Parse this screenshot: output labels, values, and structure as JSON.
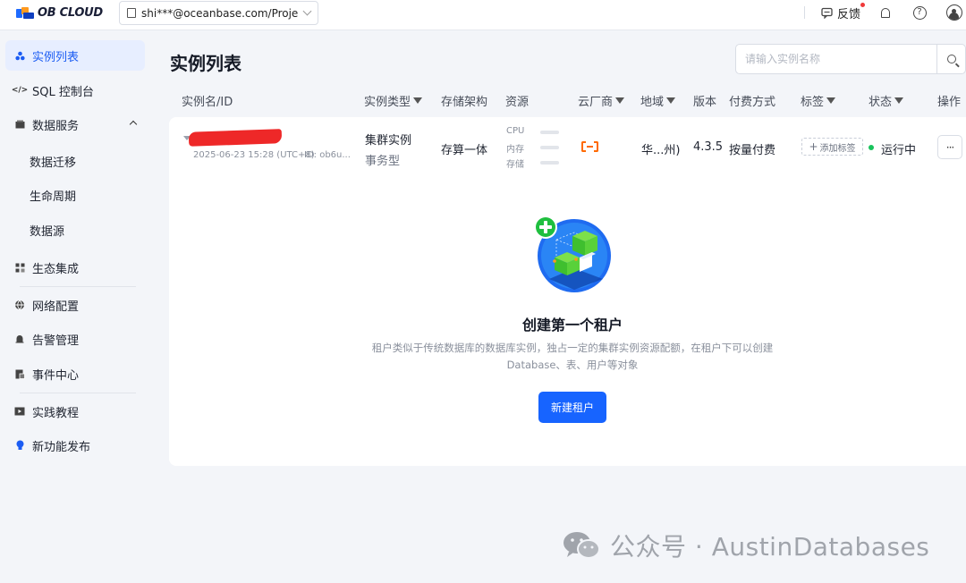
{
  "brand": {
    "name": "OB CLOUD"
  },
  "header": {
    "project": "shi***@oceanbase.com/Projec...",
    "feedback": "反馈",
    "icons": [
      "notification-icon",
      "help-icon",
      "user-icon"
    ]
  },
  "sidebar": {
    "items": [
      {
        "label": "实例列表",
        "icon": "instance-icon",
        "active": true
      },
      {
        "label": "SQL 控制台",
        "icon": "code-icon"
      },
      {
        "label": "数据服务",
        "icon": "data-service-icon",
        "expanded": true
      },
      {
        "label": "数据迁移"
      },
      {
        "label": "生命周期"
      },
      {
        "label": "数据源"
      },
      {
        "label": "生态集成",
        "icon": "ecosystem-icon"
      },
      {
        "label": "网络配置",
        "icon": "globe-icon"
      },
      {
        "label": "告警管理",
        "icon": "alarm-icon"
      },
      {
        "label": "事件中心",
        "icon": "event-icon"
      },
      {
        "label": "实践教程",
        "icon": "tutorial-icon"
      },
      {
        "label": "新功能发布",
        "icon": "bulb-icon"
      }
    ]
  },
  "main": {
    "title": "实例列表",
    "search_placeholder": "请输入实例名称",
    "columns": [
      "实例名/ID",
      "实例类型",
      "存储架构",
      "资源",
      "云厂商",
      "地域",
      "版本",
      "付费方式",
      "标签",
      "状态",
      "操作"
    ],
    "row": {
      "created": "2025-06-23 15:28 (UTC+8)",
      "id": "ID: ob6u...",
      "type": "集群实例",
      "subtype": "事务型",
      "storage": "存算一体",
      "resources": [
        "CPU",
        "内存",
        "存储"
      ],
      "vendor_icon": "alibaba-cloud-icon",
      "region": "华...州)",
      "version": "4.3.5",
      "payment": "按量付费",
      "add_tag": "添加标签",
      "status": "运行中",
      "status_color": "#19c35c",
      "more": "···"
    },
    "empty": {
      "title": "创建第一个租户",
      "description_line1": "租户类似于传统数据库的数据库实例，独占一定的集群实例资源配额，在租户下可以创建",
      "description_line2": "Database、表、用户等对象",
      "button": "新建租户"
    }
  },
  "watermark": {
    "text": "公众号 · AustinDatabases"
  },
  "colors": {
    "accent": "#1764ff",
    "active_bg": "#e7eeff",
    "vendor": "#ff6a00"
  }
}
